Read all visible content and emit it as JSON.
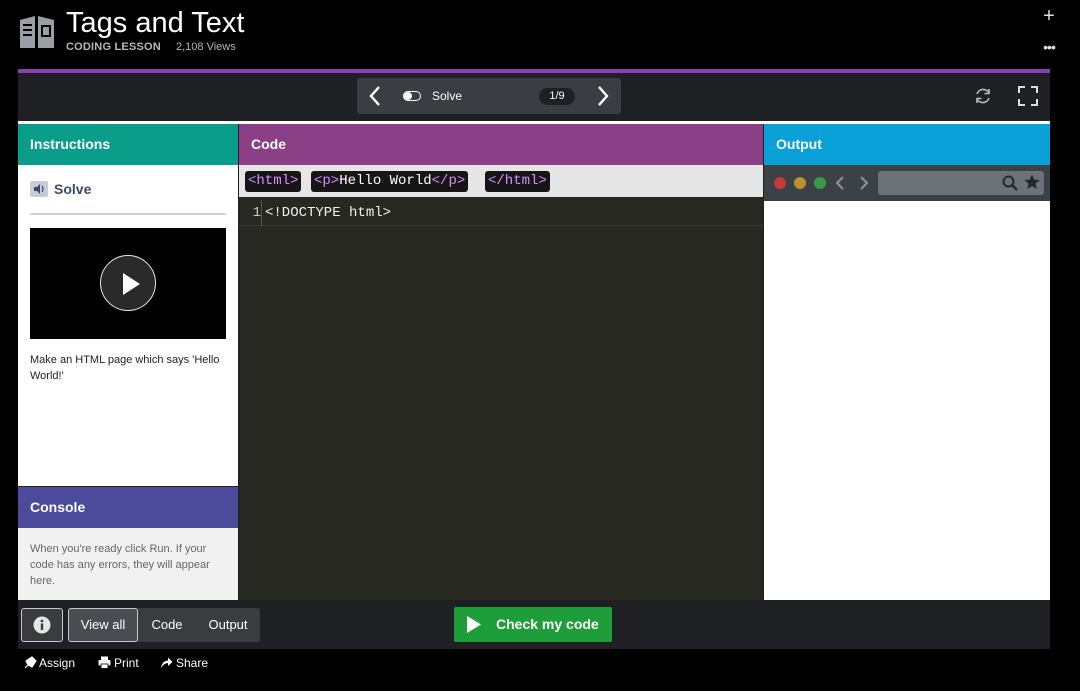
{
  "header": {
    "title": "Tags and Text",
    "type": "CODING LESSON",
    "views": "2,108 Views",
    "plus_icon": "plus-icon",
    "more_icon": "more-icon"
  },
  "toolbar": {
    "step_label": "Solve",
    "step_count": "1/9"
  },
  "instructions": {
    "heading": "Instructions",
    "section_title": "Solve",
    "text": "Make an HTML page which says 'Hello World!'"
  },
  "console": {
    "heading": "Console",
    "text": "When you're ready click Run. If your code has any errors, they will appear here."
  },
  "code": {
    "heading": "Code",
    "snippets": [
      {
        "tag_open": "<html>"
      },
      {
        "tag_open": "<p>",
        "text": "Hello World",
        "tag_close": "</p>"
      },
      {
        "tag_open": "</html>"
      }
    ],
    "lines": [
      {
        "number": "1",
        "text": "<!DOCTYPE html>"
      }
    ]
  },
  "output": {
    "heading": "Output"
  },
  "bottom": {
    "tabs": [
      "View all",
      "Code",
      "Output"
    ],
    "check_label": "Check my code"
  },
  "footer": {
    "assign": "Assign",
    "print": "Print",
    "share": "Share"
  },
  "colors": {
    "instructions": "#0a9e8a",
    "code": "#8a3f86",
    "output": "#0aa0d8",
    "console": "#4b4a9b",
    "check": "#1e9e3a",
    "accent": "#8a3fb6"
  }
}
